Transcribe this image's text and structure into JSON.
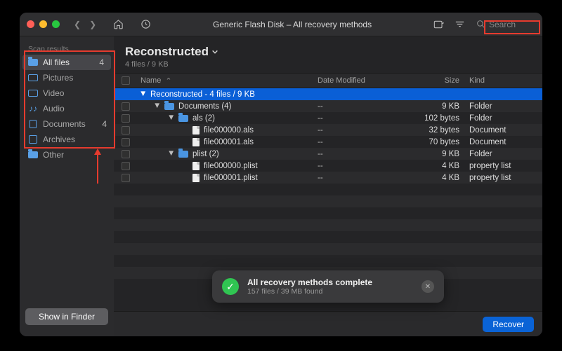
{
  "window": {
    "title": "Generic Flash Disk – All recovery methods"
  },
  "search": {
    "placeholder": "Search"
  },
  "sidebar": {
    "header": "Scan results",
    "items": [
      {
        "label": "All files",
        "count": "4",
        "icon": "folder",
        "selected": true
      },
      {
        "label": "Pictures",
        "icon": "picture"
      },
      {
        "label": "Video",
        "icon": "video"
      },
      {
        "label": "Audio",
        "icon": "audio"
      },
      {
        "label": "Documents",
        "count": "4",
        "icon": "document"
      },
      {
        "label": "Archives",
        "icon": "archive"
      },
      {
        "label": "Other",
        "icon": "folder"
      }
    ],
    "footer_button": "Show in Finder"
  },
  "main": {
    "title": "Reconstructed",
    "subtitle": "4 files / 9 KB",
    "columns": {
      "name": "Name",
      "date": "Date Modified",
      "size": "Size",
      "kind": "Kind"
    },
    "rows": [
      {
        "indent": 0,
        "sel": true,
        "chk": true,
        "tri": "down",
        "icon": "none",
        "name": "Reconstructed - 4 files / 9 KB",
        "date": "",
        "size": "",
        "kind": ""
      },
      {
        "indent": 1,
        "tri": "down",
        "icon": "folder",
        "name": "Documents (4)",
        "date": "--",
        "size": "9 KB",
        "kind": "Folder"
      },
      {
        "indent": 2,
        "tri": "down",
        "icon": "folder",
        "name": "als (2)",
        "date": "--",
        "size": "102 bytes",
        "kind": "Folder"
      },
      {
        "indent": 3,
        "icon": "file",
        "name": "file000000.als",
        "date": "--",
        "size": "32 bytes",
        "kind": "Document"
      },
      {
        "indent": 3,
        "icon": "file",
        "name": "file000001.als",
        "date": "--",
        "size": "70 bytes",
        "kind": "Document"
      },
      {
        "indent": 2,
        "tri": "down",
        "icon": "folder",
        "name": "plist (2)",
        "date": "--",
        "size": "9 KB",
        "kind": "Folder"
      },
      {
        "indent": 3,
        "icon": "file",
        "name": "file000000.plist",
        "date": "--",
        "size": "4 KB",
        "kind": "property list"
      },
      {
        "indent": 3,
        "icon": "file",
        "name": "file000001.plist",
        "date": "--",
        "size": "4 KB",
        "kind": "property list"
      }
    ]
  },
  "toast": {
    "title": "All recovery methods complete",
    "subtitle": "157 files / 39 MB found"
  },
  "footer": {
    "recover": "Recover"
  }
}
